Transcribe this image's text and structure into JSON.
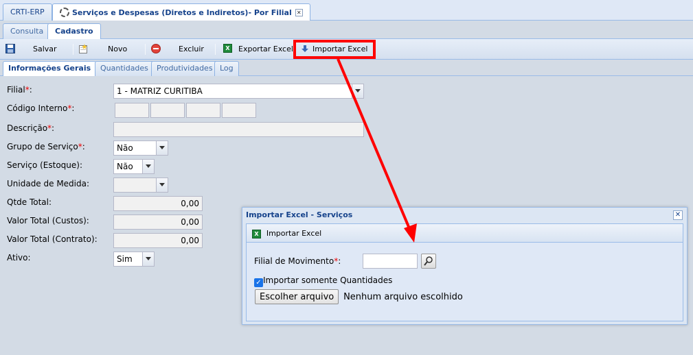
{
  "app_tabs": [
    {
      "label": "CRTI-ERP"
    },
    {
      "label": "Serviços e Despesas (Diretos e Indiretos)- Por Filial"
    }
  ],
  "mode_tabs": [
    {
      "label": "Consulta"
    },
    {
      "label": "Cadastro"
    }
  ],
  "toolbar": {
    "save_label": "Salvar",
    "new_label": "Novo",
    "delete_label": "Excluir",
    "export_label": "Exportar Excel",
    "import_label": "Importar Excel"
  },
  "sub_tabs": [
    {
      "label": "Informações Gerais"
    },
    {
      "label": "Quantidades"
    },
    {
      "label": "Produtividades"
    },
    {
      "label": "Log"
    }
  ],
  "form": {
    "filial": {
      "label": "Filial",
      "value": "1 - MATRIZ CURITIBA"
    },
    "codigo": {
      "label": "Código Interno"
    },
    "descricao": {
      "label": "Descrição"
    },
    "grupo": {
      "label": "Grupo de Serviço",
      "value": "Não"
    },
    "servico": {
      "label": "Serviço (Estoque):",
      "value": "Não"
    },
    "unidade": {
      "label": "Unidade de Medida:"
    },
    "qtde": {
      "label": "Qtde Total:",
      "value": "0,00"
    },
    "valor_custos": {
      "label": "Valor Total (Custos):",
      "value": "0,00"
    },
    "valor_contrato": {
      "label": "Valor Total (Contrato):",
      "value": "0,00"
    },
    "ativo": {
      "label": "Ativo:",
      "value": "Sim"
    },
    "req_mark": "*",
    "colon": ":"
  },
  "modal": {
    "title": "Importar Excel - Serviços",
    "bar_label": "Importar Excel",
    "filial_label": "Filial de Movimento",
    "checkbox_label": "Importar somente Quantidades",
    "checkbox_checked": true,
    "file_button": "Escolher arquivo",
    "file_status": "Nenhum arquivo escolhido"
  },
  "colors": {
    "highlight": "#ff0000",
    "accent": "#15428b",
    "required": "#ee0000"
  }
}
